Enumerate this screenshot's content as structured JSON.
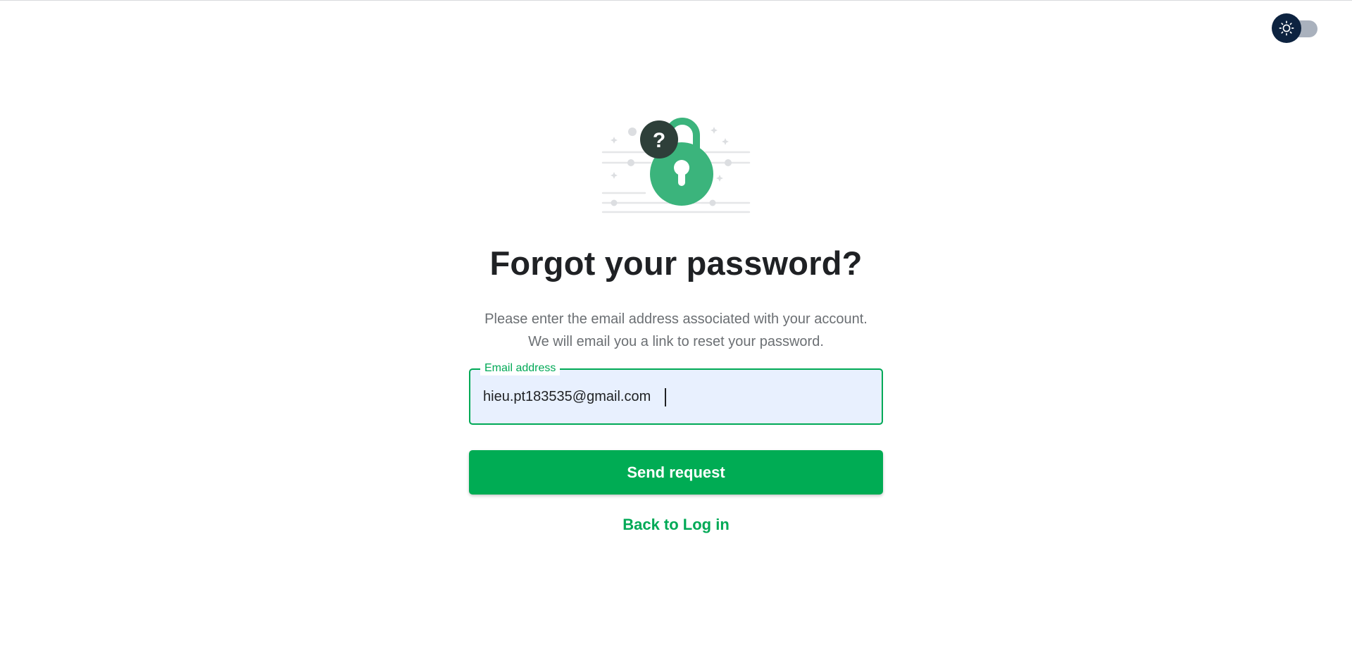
{
  "theme_toggle": {
    "icon": "sun-icon",
    "state": "light"
  },
  "illustration": {
    "icon": "lock-question-icon"
  },
  "page": {
    "title": "Forgot your password?",
    "subtitle_line1": "Please enter the email address associated with your account.",
    "subtitle_line2": "We will email you a link to reset your password."
  },
  "form": {
    "email_label": "Email address",
    "email_value": "hieu.pt183535@gmail.com",
    "submit_label": "Send request"
  },
  "links": {
    "back_label": "Back to Log in"
  },
  "colors": {
    "primary": "#00ac54",
    "accent_text": "#00a956",
    "lock_green": "#3bb47c",
    "badge_dark": "#2e3f39",
    "toggle_thumb": "#0d2340",
    "toggle_track": "#a9b1bd",
    "input_bg": "#e8f0fe"
  }
}
